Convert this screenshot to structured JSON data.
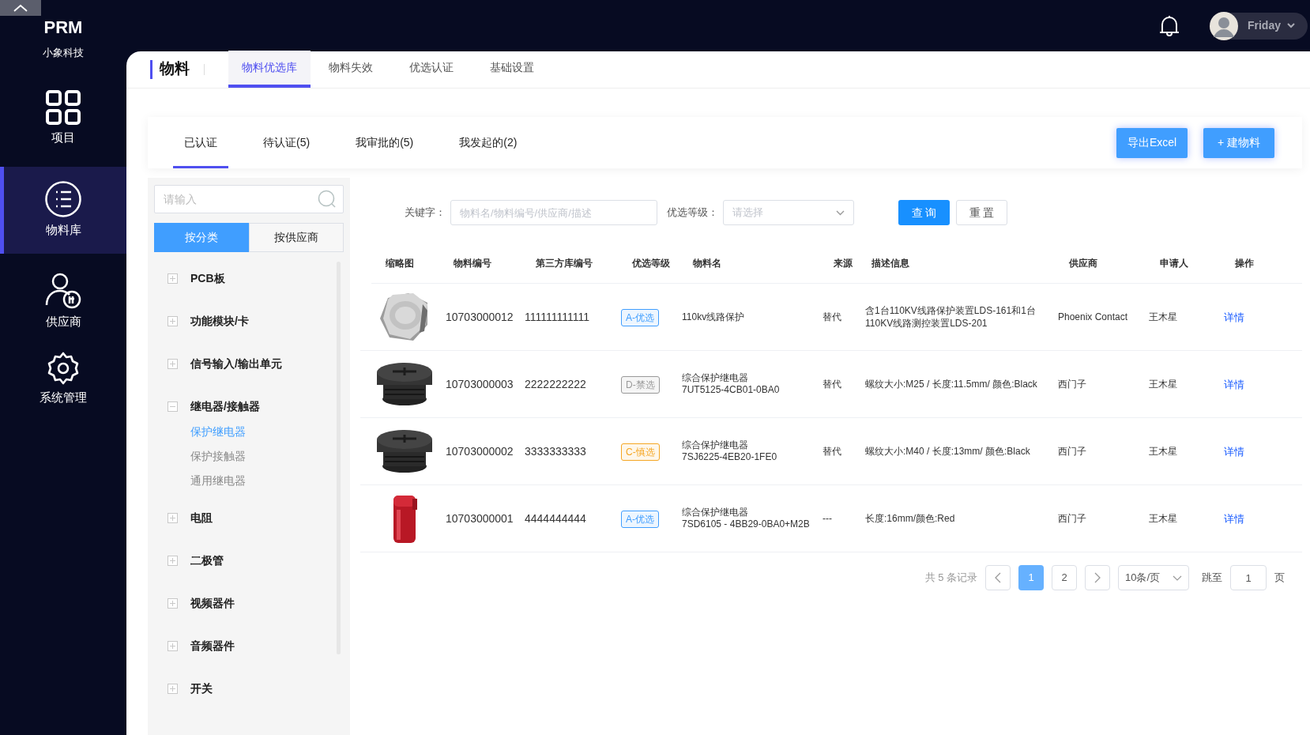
{
  "app": {
    "name": "PRM",
    "company": "小象科技"
  },
  "nav": [
    {
      "label": "项目",
      "selected": false
    },
    {
      "label": "物料库",
      "selected": true
    },
    {
      "label": "供应商",
      "selected": false
    },
    {
      "label": "系统管理",
      "selected": false
    }
  ],
  "user": {
    "name": "Friday"
  },
  "module_title": "物料",
  "module_tabs": [
    {
      "label": "物料优选库",
      "selected": true
    },
    {
      "label": "物料失效",
      "selected": false
    },
    {
      "label": "优选认证",
      "selected": false
    },
    {
      "label": "基础设置",
      "selected": false
    }
  ],
  "status_tabs": [
    {
      "label": "已认证",
      "selected": true
    },
    {
      "label": "待认证(5)",
      "selected": false
    },
    {
      "label": "我审批的(5)",
      "selected": false
    },
    {
      "label": "我发起的(2)",
      "selected": false
    }
  ],
  "actions": [
    "导出Excel",
    "+ 建物料"
  ],
  "tree_search": {
    "placeholder": "请输入"
  },
  "tree_modes": [
    {
      "label": "按分类",
      "selected": true
    },
    {
      "label": "按供应商",
      "selected": false
    }
  ],
  "tree": [
    {
      "label": "PCB板",
      "expanded": false
    },
    {
      "label": "功能模块/卡",
      "expanded": false
    },
    {
      "label": "信号输入/输出单元",
      "expanded": false
    },
    {
      "label": "继电器/接触器",
      "expanded": true,
      "children": [
        {
          "label": "保护继电器",
          "selected": true
        },
        {
          "label": "保护接触器",
          "selected": false
        },
        {
          "label": "通用继电器",
          "selected": false
        }
      ]
    },
    {
      "label": "电阻",
      "expanded": false
    },
    {
      "label": "二极管",
      "expanded": false
    },
    {
      "label": "视频器件",
      "expanded": false
    },
    {
      "label": "音频器件",
      "expanded": false
    },
    {
      "label": "开关",
      "expanded": false
    }
  ],
  "filters": {
    "keyword_label": "关键字：",
    "keyword_placeholder": "物料名/物料编号/供应商/描述",
    "grade_label": "优选等级：",
    "grade_placeholder": "请选择",
    "search_button": "查 询",
    "reset_button": "重 置"
  },
  "table": {
    "columns": [
      "缩略图",
      "物料编号",
      "第三方库编号",
      "优选等级",
      "物料名",
      "来源",
      "描述信息",
      "供应商",
      "申请人",
      "操作"
    ],
    "rows": [
      {
        "thumbnail": {
          "kind": "picture"
        },
        "code": "10703000012",
        "third_party_code": "111111111111",
        "grade": "A-优选",
        "color": "#409eff",
        "name": [
          "110kv线路保护"
        ],
        "source": "替代",
        "description": "含1台110KV线路保护装置LDS-161和1台110KV线路测控装置LDS-201",
        "supplier": "Phoenix Contact",
        "applicant": "王木星",
        "action": "详情"
      },
      {
        "thumbnail": {
          "kind": "picture"
        },
        "code": "10703000003",
        "third_party_code": "2222222222",
        "grade": "D-禁选",
        "color": "#999999",
        "name": [
          "综合保护继电器",
          "7UT5125-4CB01-0BA0"
        ],
        "source": "替代",
        "description": "螺纹大小:M25 / 长度:11.5mm/ 颜色:Black",
        "supplier": "西门子",
        "applicant": "王木星",
        "action": "详情"
      },
      {
        "thumbnail": {
          "kind": "picture"
        },
        "code": "10703000002",
        "third_party_code": "3333333333",
        "grade": "C-慎选",
        "color": "#f5a623",
        "name": [
          "综合保护继电器",
          "7SJ6225-4EB20-1FE0"
        ],
        "source": "替代",
        "description": "螺纹大小:M40 / 长度:13mm/ 颜色:Black",
        "supplier": "西门子",
        "applicant": "王木星",
        "action": "详情"
      },
      {
        "thumbnail": {
          "kind": "picture"
        },
        "code": "10703000001",
        "third_party_code": "4444444444",
        "grade": "A-优选",
        "color": "#409eff",
        "name": [
          "综合保护继电器",
          "7SD6105 - 4BB29-0BA0+M2B"
        ],
        "source": "---",
        "description": "长度:16mm/颜色:Red",
        "supplier": "西门子",
        "applicant": "王木星",
        "action": "详情"
      }
    ]
  },
  "pagination": {
    "total": "共 5 条记录",
    "pages": [
      {
        "label": "1",
        "selected": true
      },
      {
        "label": "2",
        "selected": false
      }
    ],
    "page_size": "10条/页",
    "jump_label": "跳至",
    "jump_value": "1",
    "page_unit": "页"
  }
}
